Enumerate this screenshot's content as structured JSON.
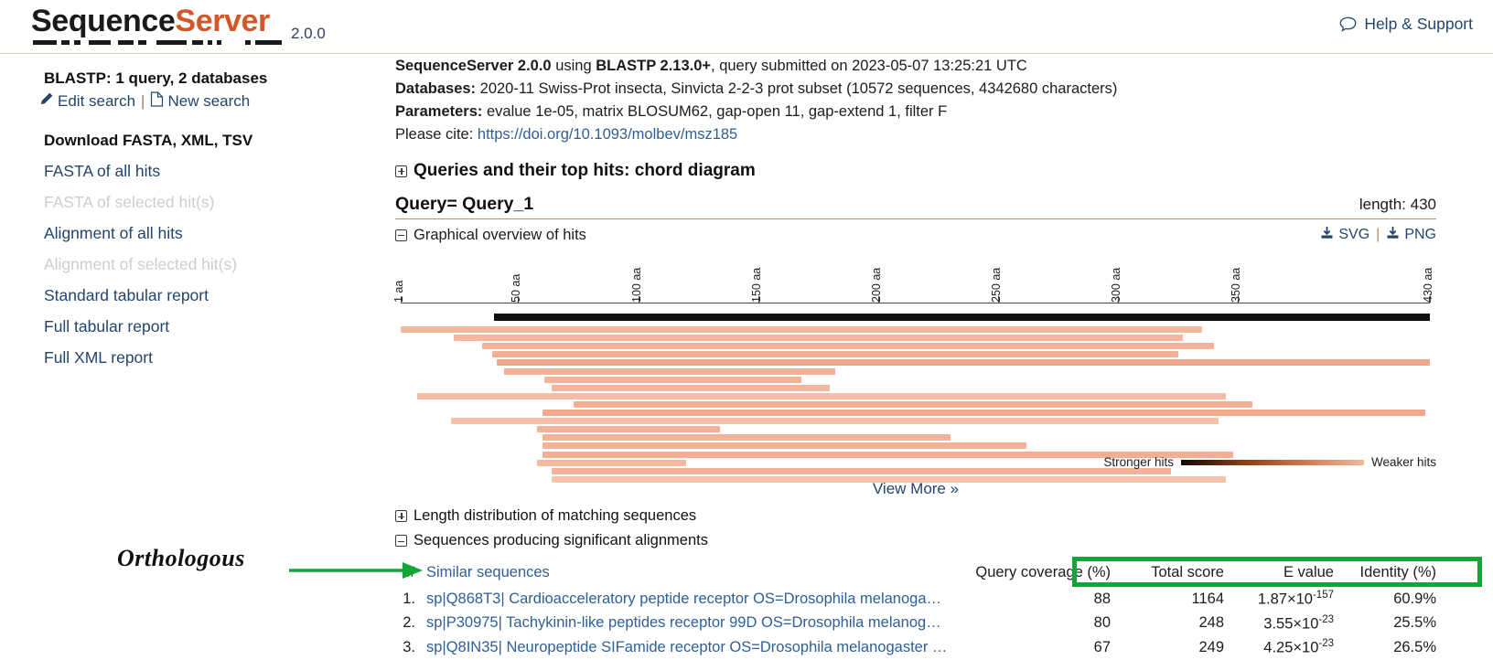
{
  "header": {
    "brand_first": "Sequence",
    "brand_second": "Server",
    "version": "2.0.0",
    "help_label": "Help & Support",
    "help_icon": "speech-bubble-icon"
  },
  "sidebar": {
    "title": "BLASTP: 1 query, 2 databases",
    "edit_search": "Edit search",
    "separator": "|",
    "new_search": "New search",
    "edit_icon": "pencil-icon",
    "new_icon": "document-icon",
    "download_title": "Download FASTA, XML, TSV",
    "links": [
      {
        "label": "FASTA of all hits",
        "disabled": false
      },
      {
        "label": "FASTA of selected hit(s)",
        "disabled": true
      },
      {
        "label": "Alignment of all hits",
        "disabled": false
      },
      {
        "label": "Alignment of selected hit(s)",
        "disabled": true
      },
      {
        "label": "Standard tabular report",
        "disabled": false
      },
      {
        "label": "Full tabular report",
        "disabled": false
      },
      {
        "label": "Full XML report",
        "disabled": false
      }
    ]
  },
  "meta": {
    "line1_bold_a": "SequenceServer 2.0.0",
    "line1_mid": " using ",
    "line1_bold_b": "BLASTP 2.13.0+",
    "line1_tail": ", query submitted on 2023-05-07 13:25:21 UTC",
    "databases_label": "Databases:",
    "databases_value": "2020-11 Swiss-Prot insecta, Sinvicta 2-2-3 prot subset (10572 sequences, 4342680 characters)",
    "parameters_label": "Parameters:",
    "parameters_value": "evalue 1e-05, matrix BLOSUM62, gap-open 11, gap-extend 1, filter F",
    "cite_label": "Please cite:",
    "cite_link": "https://doi.org/10.1093/molbev/msz185"
  },
  "chord_section": {
    "label": "Queries and their top hits: chord diagram",
    "expanded": false
  },
  "query": {
    "title": "Query= Query_1",
    "length_label": "length: 430"
  },
  "overview": {
    "label": "Graphical overview of hits",
    "expanded": true,
    "svg_label": "SVG",
    "png_label": "PNG",
    "separator": "|",
    "download_icon": "download-icon",
    "legend_strong": "Stronger hits",
    "legend_weak": "Weaker hits",
    "view_more": "View More",
    "view_more_icon": "chevron-double-down-icon"
  },
  "chart_data": {
    "type": "bar",
    "title": "Graphical overview of hits",
    "xlabel": "",
    "ylabel": "",
    "xlim": [
      1,
      430
    ],
    "grid": false,
    "legend_position": "bottom-right",
    "tick_labels": [
      "1 aa",
      "50 aa",
      "100 aa",
      "150 aa",
      "200 aa",
      "250 aa",
      "300 aa",
      "350 aa",
      "430 aa"
    ],
    "tick_values": [
      1,
      50,
      100,
      150,
      200,
      250,
      300,
      350,
      430
    ],
    "query_track": {
      "start": 40,
      "end": 430,
      "color": "#111111"
    },
    "hits": [
      {
        "start": 1,
        "end": 335,
        "color": "#f3b79a"
      },
      {
        "start": 23,
        "end": 327,
        "color": "#f5b89c"
      },
      {
        "start": 35,
        "end": 340,
        "color": "#f3b297"
      },
      {
        "start": 39,
        "end": 325,
        "color": "#f2b095"
      },
      {
        "start": 41,
        "end": 430,
        "color": "#f0a78a"
      },
      {
        "start": 44,
        "end": 182,
        "color": "#f3b297"
      },
      {
        "start": 61,
        "end": 168,
        "color": "#f3b398"
      },
      {
        "start": 64,
        "end": 180,
        "color": "#f4b79b"
      },
      {
        "start": 8,
        "end": 345,
        "color": "#f5bda3"
      },
      {
        "start": 73,
        "end": 356,
        "color": "#f2ae92"
      },
      {
        "start": 60,
        "end": 428,
        "color": "#f0a98c"
      },
      {
        "start": 22,
        "end": 342,
        "color": "#f6c1a8"
      },
      {
        "start": 58,
        "end": 134,
        "color": "#f3b297"
      },
      {
        "start": 60,
        "end": 230,
        "color": "#f3b398"
      },
      {
        "start": 60,
        "end": 262,
        "color": "#f3b196"
      },
      {
        "start": 60,
        "end": 348,
        "color": "#f2ae92"
      },
      {
        "start": 58,
        "end": 120,
        "color": "#f4b99e"
      },
      {
        "start": 64,
        "end": 322,
        "color": "#f3b398"
      },
      {
        "start": 64,
        "end": 345,
        "color": "#f6c3aa"
      }
    ]
  },
  "length_dist": {
    "label": "Length distribution of matching sequences",
    "expanded": false
  },
  "alignments": {
    "label": "Sequences producing significant alignments",
    "expanded": true,
    "columns": {
      "num": "#",
      "sequences": "Similar sequences",
      "query_coverage": "Query coverage (%)",
      "total_score": "Total score",
      "evalue": "E value",
      "identity": "Identity (%)"
    },
    "rows": [
      {
        "num": "1.",
        "sequence": "sp|Q868T3| Cardioacceleratory peptide receptor OS=Drosophila melanoga…",
        "query_coverage": "88",
        "total_score": "1164",
        "evalue_mantissa": "1.87×10",
        "evalue_exponent": "-157",
        "identity": "60.9%"
      },
      {
        "num": "2.",
        "sequence": "sp|P30975| Tachykinin-like peptides receptor 99D OS=Drosophila melanog…",
        "query_coverage": "80",
        "total_score": "248",
        "evalue_mantissa": "3.55×10",
        "evalue_exponent": "-23",
        "identity": "25.5%"
      },
      {
        "num": "3.",
        "sequence": "sp|Q8IN35| Neuropeptide SIFamide receptor OS=Drosophila melanogaster …",
        "query_coverage": "67",
        "total_score": "249",
        "evalue_mantissa": "4.25×10",
        "evalue_exponent": "-23",
        "identity": "26.5%"
      }
    ]
  },
  "annotation": {
    "text": "Orthologous",
    "arrow_color": "#13a538",
    "highlight_color": "#13a538"
  }
}
